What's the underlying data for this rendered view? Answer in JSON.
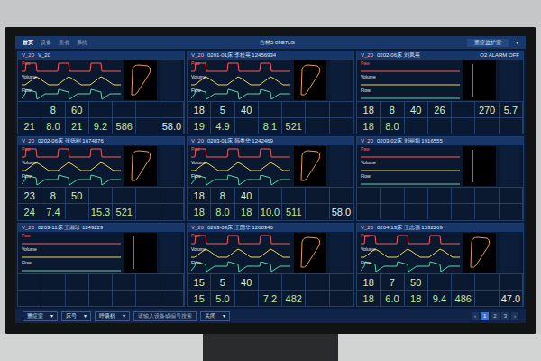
{
  "topbar": {
    "nav": [
      {
        "label": "首页",
        "selected": true
      },
      {
        "label": "设备",
        "selected": false
      },
      {
        "label": "患者",
        "selected": false
      },
      {
        "label": "系统",
        "selected": false
      }
    ],
    "center": "吉林5 89E7LG",
    "title": "重症监护室",
    "menu": "▾"
  },
  "wave_labels": [
    {
      "label": "Paw",
      "color": "#ff5a5a",
      "line": "#ff5a5a"
    },
    {
      "label": "Volume",
      "color": "#e8ecf2",
      "line": "#f2d55a"
    },
    {
      "label": "Flow",
      "color": "#e8ecf2",
      "line": "#5fd3a8"
    }
  ],
  "panels": [
    {
      "device": "V_20",
      "bed": "V_20",
      "alarm": "",
      "active": true,
      "top": [
        "",
        "8",
        "60",
        "",
        "",
        "",
        ""
      ],
      "bottom": [
        "21",
        "8.0",
        "21",
        "9.2",
        "586",
        "",
        "58.0"
      ]
    },
    {
      "device": "V_20",
      "bed": "0201-01床 李桂英 12456934",
      "alarm": "",
      "active": true,
      "top": [
        "18",
        "5",
        "40",
        "",
        "",
        "",
        ""
      ],
      "bottom": [
        "19",
        "4.9",
        "",
        "8.1",
        "521",
        "",
        ""
      ]
    },
    {
      "device": "V_20",
      "bed": "0202-06床 刘凤英",
      "alarm": "O2 ALARM OFF",
      "active": false,
      "top": [
        "18",
        "8",
        "40",
        "26",
        "",
        "270",
        "5.7"
      ],
      "bottom": [
        "18",
        "8.0",
        "",
        "",
        "",
        "",
        ""
      ]
    },
    {
      "device": "V_20",
      "bed": "0202-06床 张德刚 1674876",
      "alarm": "",
      "active": true,
      "top": [
        "23",
        "8",
        "50",
        "",
        "",
        "",
        ""
      ],
      "bottom": [
        "24",
        "7.4",
        "",
        "15.3",
        "521",
        "",
        ""
      ]
    },
    {
      "device": "V_20",
      "bed": "0203-01床 韩春华 1242469",
      "alarm": "",
      "active": true,
      "top": [
        "18",
        "8",
        "40",
        "",
        "",
        "",
        ""
      ],
      "bottom": [
        "18",
        "8.0",
        "18",
        "10.0",
        "511",
        "",
        "58.0"
      ]
    },
    {
      "device": "V_20",
      "bed": "0203-02床 刘丽娟 1916555",
      "alarm": "",
      "active": false,
      "top": [
        "",
        "",
        "",
        "",
        "",
        "",
        ""
      ],
      "bottom": [
        "",
        "",
        "",
        "",
        "",
        "",
        ""
      ]
    },
    {
      "device": "V_20",
      "bed": "0203-11床 王淑珍 1249229",
      "alarm": "",
      "active": false,
      "top": [
        "",
        "",
        "",
        "",
        "",
        "",
        ""
      ],
      "bottom": [
        "",
        "",
        "",
        "",
        "",
        "",
        ""
      ]
    },
    {
      "device": "V_20",
      "bed": "0203-03床 王国华 1268346",
      "alarm": "",
      "active": true,
      "top": [
        "15",
        "5",
        "40",
        "",
        "",
        "",
        ""
      ],
      "bottom": [
        "15",
        "5.0",
        "",
        "7.2",
        "482",
        "",
        ""
      ]
    },
    {
      "device": "V_20",
      "bed": "0204-13床 王志强 1532269",
      "alarm": "",
      "active": true,
      "top": [
        "18",
        "7",
        "50",
        "",
        "",
        "",
        ""
      ],
      "bottom": [
        "18",
        "6.0",
        "18",
        "9.4",
        "486",
        "",
        "47.0"
      ]
    }
  ],
  "footer": {
    "filters": [
      "重症室",
      "床号",
      "呼吸机"
    ],
    "search": {
      "placeholder": "请输入设备或编号搜索"
    },
    "toggle": "关闭",
    "arrow": "▾",
    "pages": [
      {
        "label": "‹",
        "selected": false
      },
      {
        "label": "1",
        "selected": true
      },
      {
        "label": "2",
        "selected": false
      },
      {
        "label": "3",
        "selected": false
      },
      {
        "label": "›",
        "selected": false
      }
    ]
  }
}
